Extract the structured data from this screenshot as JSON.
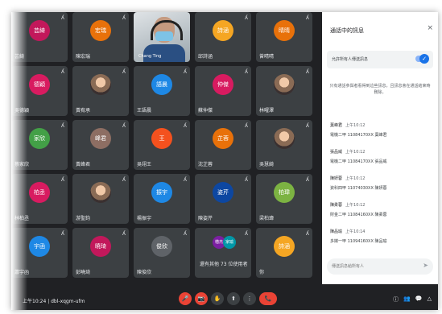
{
  "meeting": {
    "clock": "上午10:24 | dbl-xqgm-ufm"
  },
  "tiles": [
    {
      "kind": "avatar",
      "avatar": "芸綺",
      "name": "芸綺",
      "color": "#c2185b"
    },
    {
      "kind": "avatar",
      "avatar": "宏瑞",
      "name": "陳宏瑞",
      "color": "#e8710a"
    },
    {
      "kind": "video",
      "name": "Chang Ting"
    },
    {
      "kind": "avatar",
      "avatar": "詩涵",
      "name": "邱詩涵",
      "color": "#f5a623"
    },
    {
      "kind": "avatar",
      "avatar": "晴晴",
      "name": "曾晴晴",
      "color": "#e8710a"
    },
    {
      "kind": "avatar",
      "avatar": "德穎",
      "name": "吳德穎",
      "color": "#d81b60"
    },
    {
      "kind": "photo",
      "name": "黃宥承"
    },
    {
      "kind": "avatar",
      "avatar": "語晨",
      "name": "王語晨",
      "color": "#1e88e5"
    },
    {
      "kind": "avatar",
      "avatar": "仲傑",
      "name": "蘇仲傑",
      "color": "#d81b60"
    },
    {
      "kind": "photo",
      "name": "林曜澤"
    },
    {
      "kind": "avatar",
      "avatar": "家欣",
      "name": "蔡家欣",
      "color": "#43a047"
    },
    {
      "kind": "avatar",
      "avatar": "峰君",
      "name": "黃峰君",
      "color": "#8d6e63"
    },
    {
      "kind": "avatar",
      "avatar": "王",
      "name": "吳翊王",
      "color": "#f4511e"
    },
    {
      "kind": "avatar",
      "avatar": "芷蓉",
      "name": "沈芷蓉",
      "color": "#e8710a"
    },
    {
      "kind": "photo",
      "name": "吳慧綺"
    },
    {
      "kind": "avatar",
      "avatar": "柏丞",
      "name": "林柏丞",
      "color": "#d81b60"
    },
    {
      "kind": "photo",
      "name": "游聖鈞"
    },
    {
      "kind": "avatar",
      "avatar": "振宇",
      "name": "楊振宇",
      "color": "#1e88e5"
    },
    {
      "kind": "avatar",
      "avatar": "姿芹",
      "name": "陳姿芹",
      "color": "#0d47a1"
    },
    {
      "kind": "avatar",
      "avatar": "柏瑋",
      "name": "梁柏瑋",
      "color": "#7cb342"
    },
    {
      "kind": "avatar",
      "avatar": "宇函",
      "name": "蕭宇函",
      "color": "#1e88e5"
    },
    {
      "kind": "avatar",
      "avatar": "曉琦",
      "name": "彭曉琦",
      "color": "#c2185b"
    },
    {
      "kind": "avatar",
      "avatar": "俊欣",
      "name": "陳俊欣",
      "color": "#5f6368"
    },
    {
      "kind": "multi",
      "name": "還有其他 73 位使用者",
      "avatars": [
        {
          "label": "楷杰",
          "color": "#7b1fa2"
        },
        {
          "label": "家瑜",
          "color": "#0097a7"
        }
      ]
    },
    {
      "kind": "avatar",
      "avatar": "詩涵",
      "name": "你",
      "color": "#f5a623"
    }
  ],
  "panel": {
    "title": "通話中的訊息",
    "close": "×",
    "toggle_label": "允許所有人傳送訊息",
    "toggle_state": "✓",
    "notice": "只有通話參與者看得到這些訊息，且訊息會在通話結束時刪除。",
    "messages": [
      {
        "sender": "葉峰君",
        "time": "上午10:12",
        "text": "電機二甲 11084170XX 葉峰君"
      },
      {
        "sender": "張品威",
        "time": "上午10:12",
        "text": "電機二甲 11084170XX 張品威"
      },
      {
        "sender": "陳妍蓉",
        "time": "上午10:12",
        "text": "資科四甲 11074030XX 陳妍蓉"
      },
      {
        "sender": "陳柔蓉",
        "time": "上午10:12",
        "text": "財金二甲 11084160XX 陳柔蓉"
      },
      {
        "sender": "陳品瑜",
        "time": "上午10:14",
        "text": "多媒一甲 11094160XX 陳品瑜"
      }
    ],
    "compose_placeholder": "傳送訊息給所有人",
    "send_icon": "➤"
  },
  "controls": [
    "🎤",
    "📷",
    "✋",
    "⬆",
    "⋮",
    "📞"
  ],
  "right_tools": [
    "ⓘ",
    "👥",
    "💬",
    "△"
  ]
}
